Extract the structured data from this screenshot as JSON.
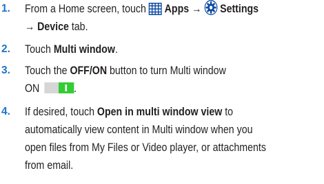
{
  "steps": [
    {
      "number": "1.",
      "t1": "From a Home screen, touch ",
      "apps": "Apps",
      "arrow1": " → ",
      "settings": "Settings",
      "arrow2": "→ ",
      "device_tab": "Device",
      "t2": " tab.",
      "icons": [
        "apps-grid-icon",
        "settings-gear-icon"
      ]
    },
    {
      "number": "2.",
      "t1": "Touch ",
      "b1": "Multi window",
      "t2": "."
    },
    {
      "number": "3.",
      "t1": "Touch the ",
      "b1": "OFF/ON",
      "t2": " button to turn Multi window",
      "t3": "ON",
      "t4": ".",
      "toggle_state": "on",
      "colors": {
        "off": "#d6d6d6",
        "on": "#33cc33"
      }
    },
    {
      "number": "4.",
      "t1": "If desired, touch ",
      "b1": "Open in multi window view",
      "t2": " to",
      "l2": "automatically view content in Multi window when you",
      "l3": "open files from My Files or Video player, or attachments",
      "l4": "from email."
    }
  ],
  "colors": {
    "number": "#1e73c8",
    "text": "#231f20",
    "icon_blue": "#0b4aa2"
  }
}
